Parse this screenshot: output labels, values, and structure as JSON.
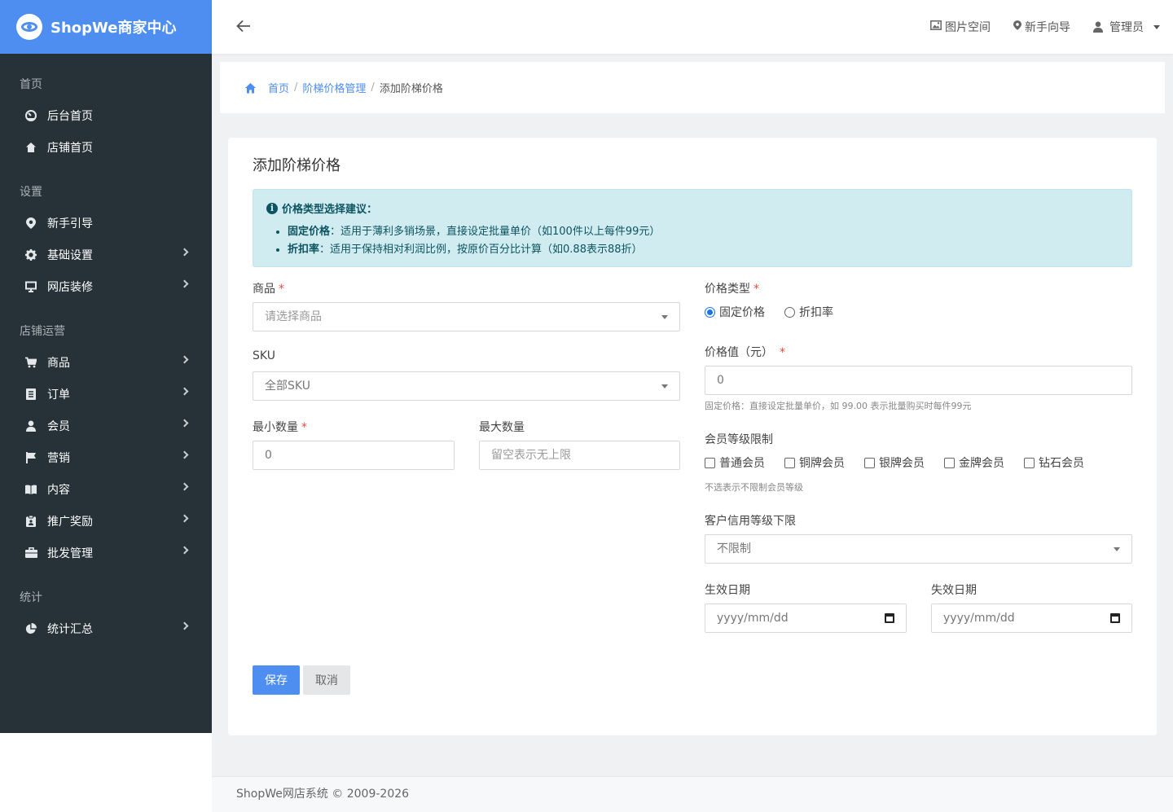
{
  "brand": {
    "title": "ShopWe商家中心"
  },
  "topbar": {
    "links": [
      {
        "label": "图片空间",
        "icon": "image-icon"
      },
      {
        "label": "新手向导",
        "icon": "map-pin-icon"
      },
      {
        "label": "管理员",
        "icon": "user-icon"
      }
    ]
  },
  "sidebar": {
    "sections": [
      {
        "title": "首页",
        "items": [
          {
            "label": "后台首页",
            "icon": "dashboard-icon",
            "expandable": false
          },
          {
            "label": "店铺首页",
            "icon": "home-icon",
            "expandable": false
          }
        ]
      },
      {
        "title": "设置",
        "items": [
          {
            "label": "新手引导",
            "icon": "map-pin-icon",
            "expandable": false
          },
          {
            "label": "基础设置",
            "icon": "gear-icon",
            "expandable": true
          },
          {
            "label": "网店装修",
            "icon": "monitor-icon",
            "expandable": true
          }
        ]
      },
      {
        "title": "店铺运营",
        "items": [
          {
            "label": "商品",
            "icon": "cart-icon",
            "expandable": true
          },
          {
            "label": "订单",
            "icon": "list-icon",
            "expandable": true
          },
          {
            "label": "会员",
            "icon": "user-icon",
            "expandable": true
          },
          {
            "label": "营销",
            "icon": "flag-icon",
            "expandable": true
          },
          {
            "label": "内容",
            "icon": "book-icon",
            "expandable": true
          },
          {
            "label": "推广奖励",
            "icon": "clipboard-icon",
            "expandable": true
          },
          {
            "label": "批发管理",
            "icon": "briefcase-icon",
            "expandable": true
          }
        ]
      },
      {
        "title": "统计",
        "items": [
          {
            "label": "统计汇总",
            "icon": "pie-chart-icon",
            "expandable": true
          }
        ]
      }
    ]
  },
  "breadcrumb": {
    "home": "首页",
    "parent": "阶梯价格管理",
    "current": "添加阶梯价格"
  },
  "form": {
    "title": "添加阶梯价格",
    "alert": {
      "heading": "价格类型选择建议：",
      "items": [
        {
          "term": "固定价格",
          "text": "：适用于薄利多销场景，直接设定批量单价（如100件以上每件99元）"
        },
        {
          "term": "折扣率",
          "text": "：适用于保持相对利润比例，按原价百分比计算（如0.88表示88折）"
        }
      ]
    },
    "product": {
      "label": "商品",
      "placeholder": "请选择商品"
    },
    "sku": {
      "label": "SKU",
      "value": "全部SKU"
    },
    "min_qty": {
      "label": "最小数量",
      "value": "0"
    },
    "max_qty": {
      "label": "最大数量",
      "placeholder": "留空表示无上限"
    },
    "price_type": {
      "label": "价格类型",
      "options": [
        "固定价格",
        "折扣率"
      ],
      "selected": "固定价格"
    },
    "price_value": {
      "label": "价格值（元）",
      "value": "0",
      "hint": "固定价格：直接设定批量单价，如 99.00 表示批量购买时每件99元"
    },
    "member_levels": {
      "label": "会员等级限制",
      "options": [
        "普通会员",
        "铜牌会员",
        "银牌会员",
        "金牌会员",
        "钻石会员"
      ],
      "hint": "不选表示不限制会员等级"
    },
    "credit_level": {
      "label": "客户信用等级下限",
      "value": "不限制"
    },
    "start_date": {
      "label": "生效日期",
      "placeholder": "yyyy/mm/dd"
    },
    "end_date": {
      "label": "失效日期",
      "placeholder": "yyyy/mm/dd"
    },
    "save_label": "保存",
    "cancel_label": "取消"
  },
  "footer": {
    "text": "ShopWe网店系统 © 2009-2026"
  },
  "colors": {
    "brand": "#4d8ef0",
    "sidebar": "#263238",
    "alert_bg": "#d1ecf1",
    "required": "#e74c3c"
  }
}
